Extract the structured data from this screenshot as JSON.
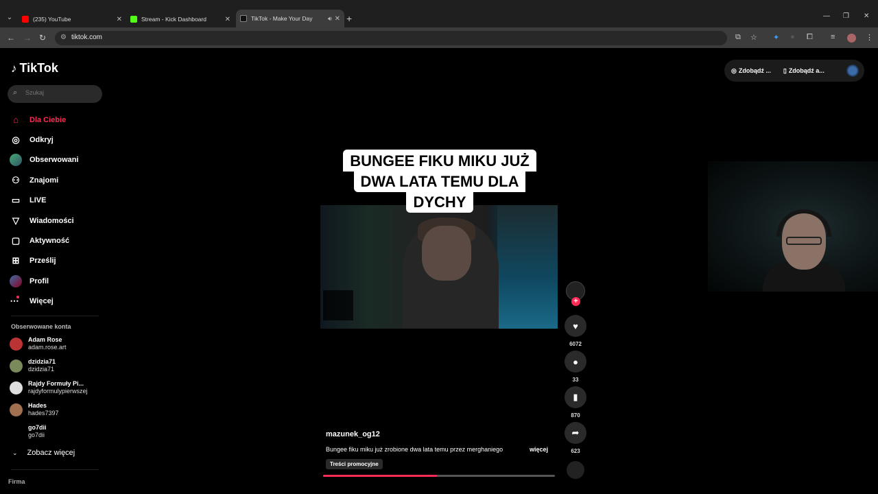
{
  "browser": {
    "tabs": [
      {
        "title": "(235) YouTube",
        "favicon_color": "#ff0000",
        "active": false
      },
      {
        "title": "Stream - Kick Dashboard",
        "favicon_color": "#53fc18",
        "active": false
      },
      {
        "title": "TikTok - Make Your Day",
        "favicon_color": "#000000",
        "active": true
      }
    ],
    "url": "tiktok.com"
  },
  "tiktok": {
    "logo": "TikTok",
    "search_placeholder": "Szukaj",
    "menu": [
      {
        "label": "Dla Ciebie",
        "icon": "home-icon",
        "active": true
      },
      {
        "label": "Odkryj",
        "icon": "compass-icon"
      },
      {
        "label": "Obserwowani",
        "icon": "following-avatar-icon"
      },
      {
        "label": "Znajomi",
        "icon": "friends-icon"
      },
      {
        "label": "LIVE",
        "icon": "live-icon"
      },
      {
        "label": "Wiadomości",
        "icon": "messages-icon"
      },
      {
        "label": "Aktywność",
        "icon": "activity-icon"
      },
      {
        "label": "Prześlij",
        "icon": "upload-icon"
      },
      {
        "label": "Profil",
        "icon": "profile-avatar-icon"
      },
      {
        "label": "Więcej",
        "icon": "more-icon"
      }
    ],
    "followed_title": "Obserwowane konta",
    "followed": [
      {
        "name": "Adam Rose",
        "handle": "adam.rose.art",
        "color": "#b33"
      },
      {
        "name": "dzidzia71",
        "handle": "dzidzia71",
        "color": "#7a8a5a"
      },
      {
        "name": "Rajdy Formuły Pi...",
        "handle": "rajdyformulypierwszej",
        "color": "#ddd"
      },
      {
        "name": "Hades",
        "handle": "hades7397",
        "color": "#a07050"
      },
      {
        "name": "go7dii",
        "handle": "go7dii",
        "color": "#000"
      }
    ],
    "see_more": "Zobacz więcej",
    "footer": "Firma",
    "top_buttons": [
      "Zdobądź ...",
      "Zdobądź a..."
    ],
    "video": {
      "caption_lines": [
        "BUNGEE FIKU MIKU JUŻ",
        "DWA LATA TEMU DLA",
        "DYCHY"
      ],
      "author": "mazunek_og12",
      "description": "Bungee fiku miku już zrobione dwa lata temu przez merghaniego",
      "more": "więcej",
      "promo": "Treści promocyjne",
      "progress": 0.49,
      "likes": "6072",
      "comments": "33",
      "saves": "870",
      "shares": "623"
    }
  }
}
